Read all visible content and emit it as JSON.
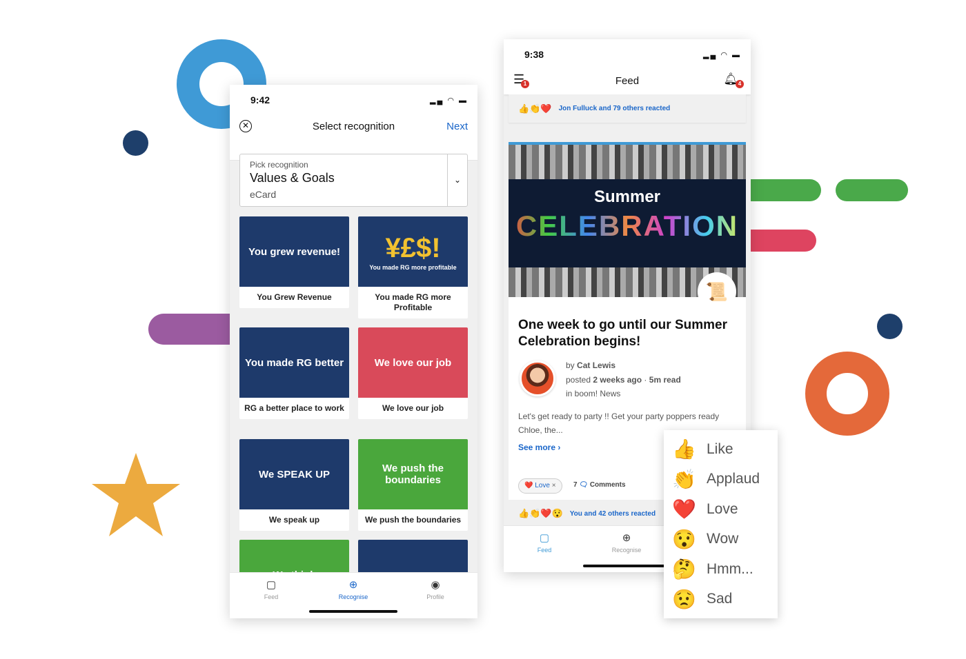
{
  "left_phone": {
    "time": "9:42",
    "header": {
      "title": "Select recognition",
      "next": "Next"
    },
    "picker": {
      "label": "Pick recognition",
      "value": "Values & Goals",
      "subtitle": "eCard"
    },
    "cards": [
      {
        "image_text": "You grew revenue!",
        "label": "You Grew Revenue",
        "color": "#1e3a6b"
      },
      {
        "image_text": "¥£$!",
        "image_sub": "You made RG more profitable",
        "label": "You made RG more Profitable",
        "color": "#1e3a6b"
      },
      {
        "image_text": "You made RG better",
        "label": "RG a better place to work",
        "color": "#1e3a6b"
      },
      {
        "image_text": "We love our job",
        "label": "We love our job",
        "color": "#d94a5a"
      },
      {
        "image_text": "We SPEAK UP",
        "label": "We speak up",
        "color": "#1e3a6b"
      },
      {
        "image_text": "We push the boundaries",
        "label": "We push the boundaries",
        "color": "#4aa73c"
      },
      {
        "image_text": "We think",
        "label": "",
        "color": "#4aa73c"
      },
      {
        "image_text": "",
        "label": "",
        "color": "#1e3a6b"
      }
    ],
    "tabs": [
      {
        "label": "Feed",
        "icon": "feed-icon"
      },
      {
        "label": "Recognise",
        "icon": "plus-circle-icon",
        "active": true
      },
      {
        "label": "Profile",
        "icon": "profile-icon"
      }
    ]
  },
  "right_phone": {
    "time": "9:38",
    "header": {
      "title": "Feed",
      "filter_badge": "1",
      "bell_badge": "4"
    },
    "top_reactions": "Jon Fulluck and 79 others reacted",
    "post": {
      "banner_title": "Summer",
      "banner_word": "CELEBRATION",
      "title": "One week to go until our Summer Celebration begins!",
      "by_prefix": "by",
      "author": "Cat Lewis",
      "posted_prefix": "posted",
      "posted": "2 weeks ago",
      "read": "5m read",
      "category": "in boom! News",
      "excerpt": "Let's get ready to party !! Get your party poppers ready Chloe, the...",
      "see_more": "See more ›",
      "love_pill": "Love",
      "comments_count": "7",
      "comments_label": "Comments",
      "reactions_text": "You and 42 others reacted"
    },
    "tabs": [
      {
        "label": "Feed",
        "icon": "feed-icon",
        "active": true
      },
      {
        "label": "Recognise",
        "icon": "plus-circle-icon"
      }
    ]
  },
  "reaction_menu": [
    {
      "label": "Like",
      "emoji": "👍"
    },
    {
      "label": "Applaud",
      "emoji": "👏"
    },
    {
      "label": "Love",
      "emoji": "❤️"
    },
    {
      "label": "Wow",
      "emoji": "😯"
    },
    {
      "label": "Hmm...",
      "emoji": "🤔"
    },
    {
      "label": "Sad",
      "emoji": "😟"
    }
  ],
  "colors": {
    "accent": "#1a66c9",
    "badge": "#d8322b",
    "ring_blue": "#3f9ad6",
    "ring_orange": "#e4693a",
    "green": "#4aa94a",
    "red": "#de4460",
    "purple": "#9b5ba0",
    "star": "#ecaa3f",
    "navy": "#1e3f6b"
  }
}
